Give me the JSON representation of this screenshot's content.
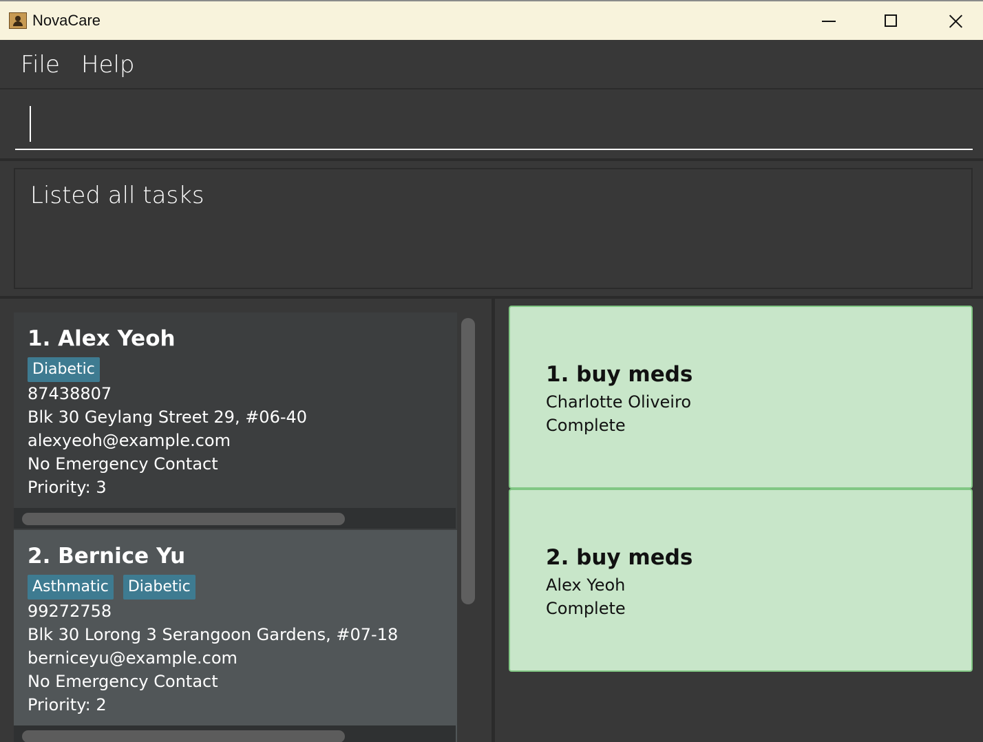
{
  "window": {
    "title": "NovaCare"
  },
  "menu": {
    "file": "File",
    "help": "Help"
  },
  "command": {
    "value": "",
    "placeholder": ""
  },
  "result": {
    "message": "Listed all tasks"
  },
  "persons": [
    {
      "name": "1. Alex Yeoh",
      "tags": [
        "Diabetic"
      ],
      "phone": "87438807",
      "address": "Blk 30 Geylang Street 29, #06-40",
      "email": "alexyeoh@example.com",
      "emergency": "No Emergency Contact",
      "priority": "Priority: 3"
    },
    {
      "name": "2. Bernice Yu",
      "tags": [
        "Asthmatic",
        "Diabetic"
      ],
      "phone": "99272758",
      "address": "Blk 30 Lorong 3 Serangoon Gardens, #07-18",
      "email": "berniceyu@example.com",
      "emergency": "No Emergency Contact",
      "priority": "Priority: 2"
    }
  ],
  "tasks": [
    {
      "name": "1. buy meds",
      "person": "Charlotte Oliveiro",
      "status": "Complete"
    },
    {
      "name": "2. buy meds",
      "person": "Alex Yeoh",
      "status": "Complete"
    }
  ],
  "colors": {
    "background": "#383838",
    "tag": "#3e7b91",
    "task_card": "#c8e6c9",
    "task_border": "#81c784",
    "titlebar": "#f8f3dc"
  }
}
